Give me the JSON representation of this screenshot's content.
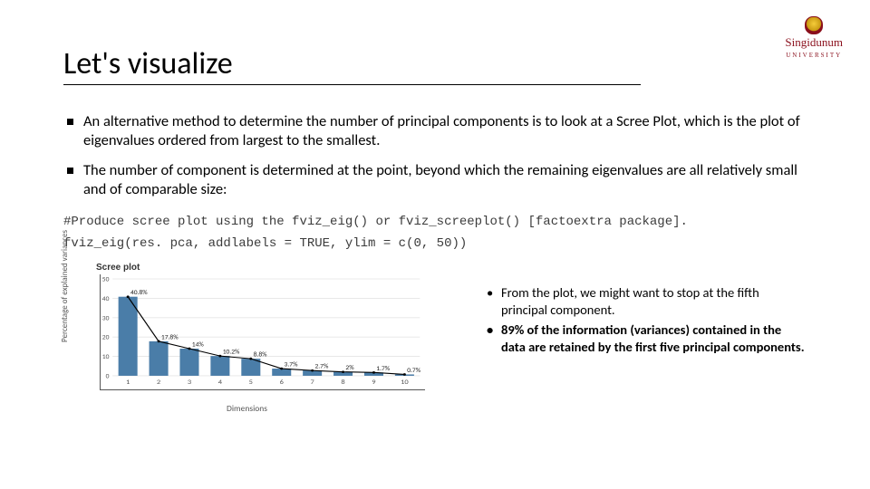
{
  "logo": {
    "name": "Singidunum",
    "sub": "UNIVERSITY"
  },
  "title": "Let's visualize",
  "bullets": [
    "An alternative method to determine the number of principal components is to look at a Scree Plot, which is the plot of eigenvalues ordered from largest to the smallest.",
    "The number of component is determined at the point, beyond which the remaining eigenvalues are all relatively small and of comparable size:"
  ],
  "code": {
    "l1": "#Produce scree plot using the fviz_eig() or fviz_screeplot() [factoextra package].",
    "l2": "fviz_eig(res. pca, addlabels = TRUE, ylim = c(0, 50))"
  },
  "chart_data": {
    "type": "bar",
    "title": "Scree plot",
    "xlabel": "Dimensions",
    "ylabel": "Percentage of explained variances",
    "categories": [
      "1",
      "2",
      "3",
      "4",
      "5",
      "6",
      "7",
      "8",
      "9",
      "10"
    ],
    "values": [
      40.8,
      17.8,
      14,
      10.2,
      8.8,
      3.7,
      2.7,
      2,
      1.7,
      0.7
    ],
    "value_labels": [
      "40.8%",
      "17.8%",
      "14%",
      "10.2%",
      "8.8%",
      "3.7%",
      "2.7%",
      "2%",
      "1.7%",
      "0.7%"
    ],
    "yticks": [
      0,
      10,
      20,
      30,
      40,
      50
    ],
    "ylim": [
      0,
      50
    ]
  },
  "notes": [
    {
      "text": "From the plot, we might want to stop at the fifth principal component.",
      "bold": false
    },
    {
      "text": "89% of the information (variances) contained in the data are retained by the first five principal components.",
      "bold": true
    }
  ]
}
